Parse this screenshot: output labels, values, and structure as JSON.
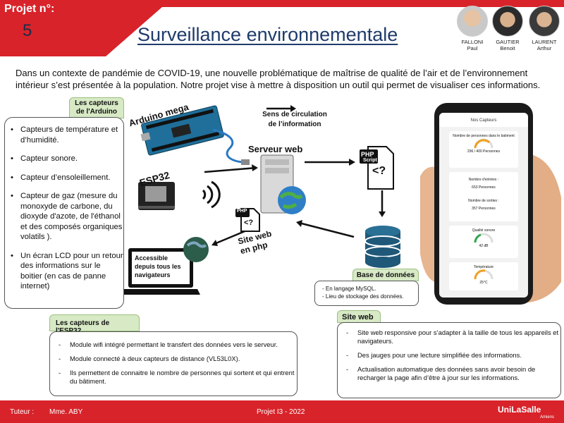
{
  "header": {
    "project_label": "Projet n°:",
    "project_number": "5",
    "title": "Surveillance environnementale",
    "members": [
      {
        "last": "FALLONI",
        "first": "Paul"
      },
      {
        "last": "GAUTIER",
        "first": "Benoit"
      },
      {
        "last": "LAURENT",
        "first": "Arthur"
      }
    ]
  },
  "intro": "Dans un contexte de pandémie de COVID-19, une nouvelle problématique de maîtrise de qualité de l’air et de l’environnement intérieur s’est présentée à la population. Notre projet vise à mettre à disposition un outil qui permet de visualiser ces informations.",
  "arduino_section": {
    "tag": "Les capteurs de l'Arduino",
    "items": [
      "Capteurs de température et d’humidité.",
      "Capteur sonore.",
      "Capteur d’ensoleillement.",
      "Capteur de gaz (mesure du monoxyde de carbone, du dioxyde d'azote, de l'éthanol et des composés organiques volatils ).",
      "Un écran LCD pour un retour des informations sur le boitier (en cas de panne internet)"
    ]
  },
  "diagram": {
    "arduino_label": "Arduino mega",
    "esp32_label": "ESP32",
    "flow_label": "Sens de circulation de l’information",
    "server_label": "Serveur web",
    "php_label": "PHP",
    "php_script_label": "Script",
    "php_code": "<?",
    "site_web_label": "Site web en php",
    "laptop_label": "Accessible depuis tous les navigateurs",
    "db_label": "Base de données"
  },
  "db_section": {
    "items": [
      "- En langage MySQL.",
      "- Lieu de stockage des données."
    ]
  },
  "esp_section": {
    "tag": "Les capteurs de l'ESP32",
    "items": [
      "Module wifi intégré permettant le transfert des données vers le serveur.",
      "Module connecté à deux capteurs de distance (VL53L0X).",
      "Ils permettent de connaitre le nombre de personnes qui sortent et qui entrent du bâtiment."
    ]
  },
  "site_section": {
    "tag": "Site web",
    "items": [
      "Site web responsive pour s’adapter à la taille de tous les appareils et navigateurs.",
      "Des jauges pour une lecture simplifiée des informations.",
      "Actualisation automatique des données sans avoir besoin de recharger la page afin d’être à jour sur les informations."
    ]
  },
  "phone": {
    "header": "Nos Capteurs",
    "card1_label": "Nombre de personnes dans le batiment",
    "card1_value": "296 / 400 Personnes",
    "card1_level": 0.74,
    "card2_label1": "Nombre d'entrées :",
    "card2_value1": "653 Personnes",
    "card2_label2": "Nombre de sorties :",
    "card2_value2": "357 Personnes",
    "card3_label": "Qualité sonore",
    "card3_value": "42 dB",
    "card4_label": "Température",
    "card4_value": "25°C"
  },
  "footer": {
    "tutor_label": "Tuteur :",
    "tutor_name": "Mme. ABY",
    "center": "Projet I3 - 2022",
    "brand": "UniLaSalle",
    "brand_sub": "Amiens"
  },
  "colors": {
    "accent_red": "#d8232a",
    "title_blue": "#1f3b6b",
    "tag_green": "#d7e9c5",
    "server_arrow": "#111111"
  }
}
